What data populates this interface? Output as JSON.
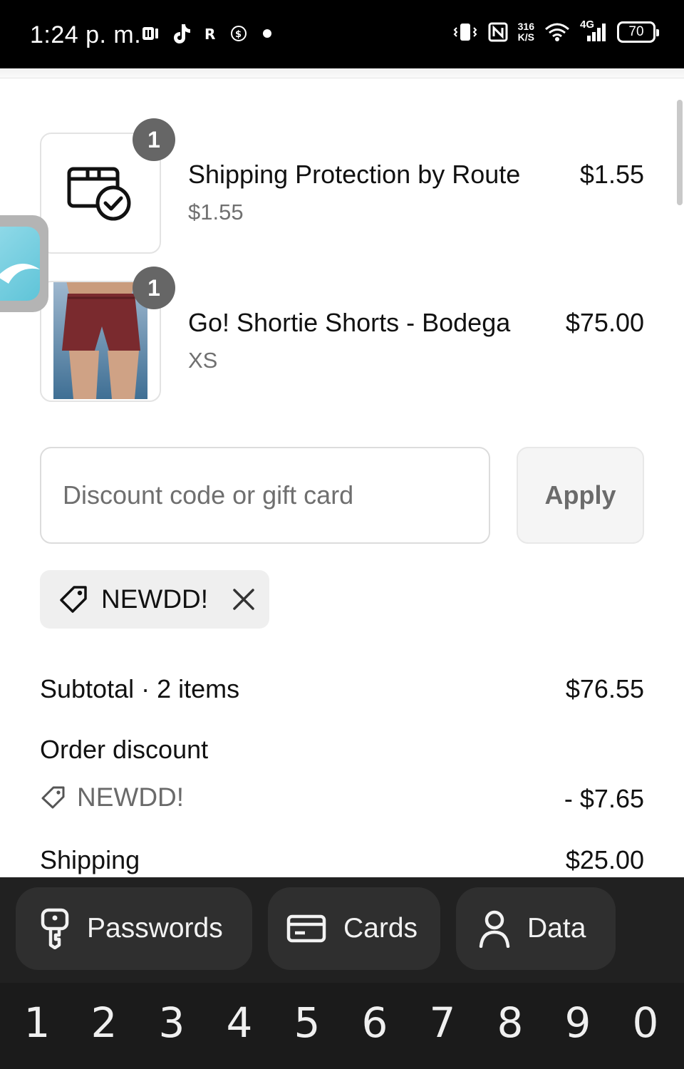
{
  "status_bar": {
    "time": "1:24 p. m.",
    "left_icons": [
      "notification-app-icon",
      "tiktok-icon",
      "r-app-icon",
      "dollar-app-icon",
      "dot-indicator-icon"
    ],
    "network_speed_value": "316",
    "network_speed_unit": "K/S",
    "network_type": "4G",
    "battery": "70"
  },
  "line_items": [
    {
      "quantity": "1",
      "name": "Shipping Protection by Route",
      "subtitle": "$1.55",
      "price": "$1.55",
      "icon": "package-check-icon"
    },
    {
      "quantity": "1",
      "name": "Go! Shortie Shorts - Bodega",
      "subtitle": "XS",
      "price": "$75.00",
      "icon": "product-photo"
    }
  ],
  "discount": {
    "placeholder": "Discount code or gift card",
    "value": "",
    "apply_label": "Apply",
    "applied_code": "NEWDD!"
  },
  "summary": {
    "subtotal_label": "Subtotal · 2 items",
    "subtotal_value": "$76.55",
    "order_discount_label": "Order discount",
    "discount_code": "NEWDD!",
    "discount_value": "- $7.65",
    "shipping_label": "Shipping",
    "shipping_value": "$25.00"
  },
  "autofill": {
    "passwords_label": "Passwords",
    "cards_label": "Cards",
    "data_label": "Data"
  },
  "number_keys": [
    "1",
    "2",
    "3",
    "4",
    "5",
    "6",
    "7",
    "8",
    "9",
    "0"
  ],
  "colors": {
    "status_bar_bg": "#000000",
    "badge_bg": "#666666",
    "keyboard_bg": "#1b1b1b",
    "autofill_chip_bg": "#2f2f2f",
    "shorts_color": "#7a2a2e"
  }
}
